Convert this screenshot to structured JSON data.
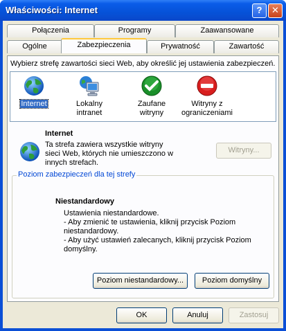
{
  "window": {
    "title": "Właściwości: Internet",
    "help_label": "?",
    "close_label": "✕"
  },
  "tabs": {
    "row_back": [
      {
        "label": "Połączenia"
      },
      {
        "label": "Programy"
      },
      {
        "label": "Zaawansowane"
      }
    ],
    "row_front": [
      {
        "label": "Ogólne"
      },
      {
        "label": "Zabezpieczenia",
        "active": true
      },
      {
        "label": "Prywatność"
      },
      {
        "label": "Zawartość"
      }
    ]
  },
  "zones": {
    "instruction": "Wybierz strefę zawartości sieci Web, aby określić jej ustawienia zabezpieczeń.",
    "items": [
      {
        "label": "Internet",
        "icon": "globe-icon",
        "selected": true
      },
      {
        "label_line1": "Lokalny",
        "label_line2": "intranet",
        "icon": "local-intranet-icon"
      },
      {
        "label_line1": "Zaufane",
        "label_line2": "witryny",
        "icon": "trusted-check-icon"
      },
      {
        "label_line1": "Witryny z",
        "label_line2": "ograniczeniami",
        "icon": "restricted-no-entry-icon"
      }
    ]
  },
  "selected_zone": {
    "title": "Internet",
    "desc_line1": "Ta strefa zawiera wszystkie witryny",
    "desc_line2": "sieci Web, których nie umieszczono w",
    "desc_line3": "innych strefach.",
    "sites_button": "Witryny..."
  },
  "security_level": {
    "legend": "Poziom zabezpieczeń dla tej strefy",
    "title": "Niestandardowy",
    "lines": [
      "Ustawienia niestandardowe.",
      "- Aby zmienić te ustawienia, kliknij przycisk Poziom",
      "niestandardowy.",
      "- Aby użyć ustawień zalecanych, kliknij przycisk Poziom",
      "domyślny."
    ],
    "custom_level_button": "Poziom niestandardowy...",
    "default_level_button": "Poziom domyślny"
  },
  "buttons": {
    "ok": "OK",
    "cancel": "Anuluj",
    "apply": "Zastosuj"
  },
  "colors": {
    "titlebar": "#0a5ce8",
    "dialog_bg": "#ece9d8",
    "active_tab_accent": "#ffc83c",
    "legend_text": "#0046d5",
    "selection": "#316ac5"
  }
}
